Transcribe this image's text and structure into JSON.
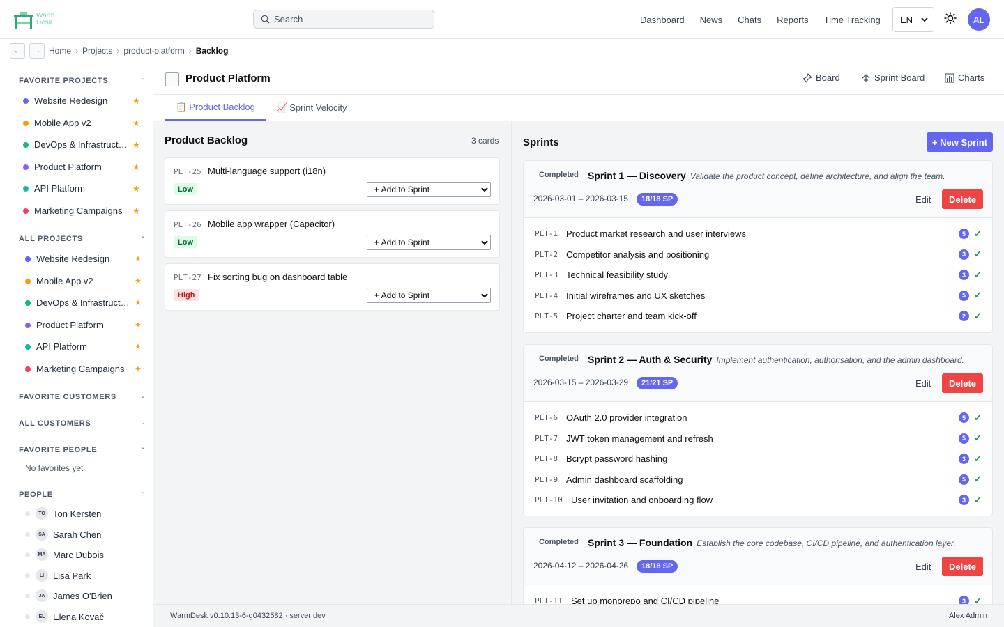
{
  "app": {
    "logo_text": "Warm Desk",
    "user_initials": "AL"
  },
  "search": {
    "placeholder": "Search"
  },
  "nav": [
    "Dashboard",
    "News",
    "Chats",
    "Reports",
    "Time Tracking"
  ],
  "language": {
    "selected": "EN"
  },
  "breadcrumb": {
    "items": [
      "Home",
      "Projects",
      "product-platform"
    ],
    "current": "Backlog"
  },
  "sidebar": {
    "favorite_projects_title": "FAVORITE PROJECTS",
    "favorite_projects": [
      {
        "name": "Website Redesign",
        "color": "#6366f1"
      },
      {
        "name": "Mobile App v2",
        "color": "#f59e0b"
      },
      {
        "name": "DevOps & Infrastruct…",
        "color": "#10b981"
      },
      {
        "name": "Product Platform",
        "color": "#8b5cf6"
      },
      {
        "name": "API Platform",
        "color": "#14b8a6"
      },
      {
        "name": "Marketing Campaigns",
        "color": "#f43f5e"
      }
    ],
    "all_projects_title": "ALL PROJECTS",
    "all_projects": [
      {
        "name": "Website Redesign",
        "color": "#6366f1"
      },
      {
        "name": "Mobile App v2",
        "color": "#f59e0b"
      },
      {
        "name": "DevOps & Infrastruct…",
        "color": "#10b981"
      },
      {
        "name": "Product Platform",
        "color": "#8b5cf6"
      },
      {
        "name": "API Platform",
        "color": "#14b8a6"
      },
      {
        "name": "Marketing Campaigns",
        "color": "#f43f5e"
      }
    ],
    "favorite_customers_title": "FAVORITE CUSTOMERS",
    "all_customers_title": "ALL CUSTOMERS",
    "favorite_people_title": "FAVORITE PEOPLE",
    "favorite_people_empty": "No favorites yet",
    "people_title": "PEOPLE",
    "people": [
      {
        "initials": "TO",
        "name": "Ton Kersten"
      },
      {
        "initials": "SA",
        "name": "Sarah Chen"
      },
      {
        "initials": "MA",
        "name": "Marc Dubois"
      },
      {
        "initials": "LI",
        "name": "Lisa Park"
      },
      {
        "initials": "JA",
        "name": "James O'Brien"
      },
      {
        "initials": "EL",
        "name": "Elena Kovač"
      }
    ]
  },
  "project": {
    "title": "Product Platform",
    "actions": [
      "Board",
      "Sprint Board",
      "Charts"
    ],
    "tabs": [
      "Product Backlog",
      "Sprint Velocity"
    ]
  },
  "backlog": {
    "title": "Product Backlog",
    "count": "3 cards",
    "add_label": "+ Add to Sprint",
    "cards": [
      {
        "key": "PLT-25",
        "title": "Multi-language support (i18n)",
        "priority": "Low",
        "level": "low"
      },
      {
        "key": "PLT-26",
        "title": "Mobile app wrapper (Capacitor)",
        "priority": "Low",
        "level": "low"
      },
      {
        "key": "PLT-27",
        "title": "Fix sorting bug on dashboard table",
        "priority": "High",
        "level": "high"
      }
    ]
  },
  "sprints": {
    "title": "Sprints",
    "new_label": "+ New Sprint",
    "edit_label": "Edit",
    "delete_label": "Delete",
    "items": [
      {
        "status": "Completed",
        "name": "Sprint 1 — Discovery",
        "description": "Validate the product concept, define architecture, and align the team.",
        "dates": "2026-03-01 – 2026-03-15",
        "points": "18/18 SP",
        "tasks": [
          {
            "key": "PLT-1",
            "title": "Product market research and user interviews",
            "points": "5"
          },
          {
            "key": "PLT-2",
            "title": "Competitor analysis and positioning",
            "points": "3"
          },
          {
            "key": "PLT-3",
            "title": "Technical feasibility study",
            "points": "3"
          },
          {
            "key": "PLT-4",
            "title": "Initial wireframes and UX sketches",
            "points": "5"
          },
          {
            "key": "PLT-5",
            "title": "Project charter and team kick-off",
            "points": "2"
          }
        ]
      },
      {
        "status": "Completed",
        "name": "Sprint 2 — Auth & Security",
        "description": "Implement authentication, authorisation, and the admin dashboard.",
        "dates": "2026-03-15 – 2026-03-29",
        "points": "21/21 SP",
        "tasks": [
          {
            "key": "PLT-6",
            "title": "OAuth 2.0 provider integration",
            "points": "5"
          },
          {
            "key": "PLT-7",
            "title": "JWT token management and refresh",
            "points": "5"
          },
          {
            "key": "PLT-8",
            "title": "Bcrypt password hashing",
            "points": "3"
          },
          {
            "key": "PLT-9",
            "title": "Admin dashboard scaffolding",
            "points": "5"
          },
          {
            "key": "PLT-10",
            "title": "User invitation and onboarding flow",
            "points": "3"
          }
        ]
      },
      {
        "status": "Completed",
        "name": "Sprint 3 — Foundation",
        "description": "Establish the core codebase, CI/CD pipeline, and authentication layer.",
        "dates": "2026-04-12 – 2026-04-26",
        "points": "18/18 SP",
        "tasks": [
          {
            "key": "PLT-11",
            "title": "Set up monorepo and CI/CD pipeline",
            "points": "3"
          }
        ]
      }
    ]
  },
  "footer": {
    "version": "WarmDesk v0.10.13-6-g0432582",
    "server": "· server dev",
    "user": "Alex Admin"
  },
  "colors": {
    "accent": "#6366f1",
    "danger": "#ef4444",
    "success": "#16a34a",
    "star": "#f59e0b"
  }
}
